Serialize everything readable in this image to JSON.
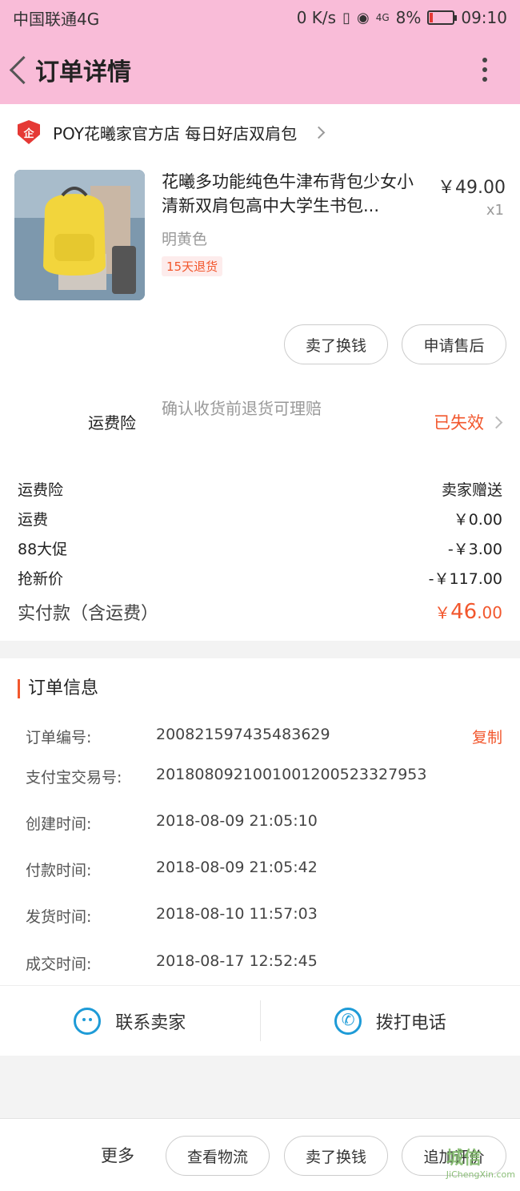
{
  "status_bar": {
    "carrier": "中国联通4G",
    "speed": "0 K/s",
    "signal": "4G",
    "battery": "8%",
    "time": "09:10"
  },
  "header": {
    "title": "订单详情"
  },
  "shop": {
    "badge": "企",
    "name": "POY花曦家官方店 每日好店双肩包"
  },
  "product": {
    "title": "花曦多功能纯色牛津布背包少女小清新双肩包高中大学生书包...",
    "price": "￥49.00",
    "qty": "x1",
    "color": "明黄色",
    "tag": "15天退货",
    "buttons": {
      "sell": "卖了换钱",
      "after_sale": "申请售后"
    }
  },
  "insurance": {
    "label": "运费险",
    "desc": "确认收货前退货可理赔",
    "status": "已失效"
  },
  "fees": {
    "rows": [
      {
        "label": "运费险",
        "value": "卖家赠送"
      },
      {
        "label": "运费",
        "value": "￥0.00"
      },
      {
        "label": "88大促",
        "value": "-￥3.00"
      },
      {
        "label": "抢新价",
        "value": "-￥117.00"
      }
    ],
    "total_label": "实付款（含运费）",
    "total_currency": "￥",
    "total_int": "46",
    "total_dec": ".00"
  },
  "order_info": {
    "heading": "订单信息",
    "copy_label": "复制",
    "rows": [
      {
        "label": "订单编号:",
        "value": "200821597435483629"
      },
      {
        "label": "支付宝交易号:",
        "value": "2018080921001001200523327953"
      },
      {
        "label": "创建时间:",
        "value": "2018-08-09 21:05:10"
      },
      {
        "label": "付款时间:",
        "value": "2018-08-09 21:05:42"
      },
      {
        "label": "发货时间:",
        "value": "2018-08-10 11:57:03"
      },
      {
        "label": "成交时间:",
        "value": "2018-08-17 12:52:45"
      }
    ]
  },
  "contact": {
    "seller": "联系卖家",
    "call": "拨打电话"
  },
  "bottom": {
    "more": "更多",
    "logistics": "查看物流",
    "sell": "卖了换钱",
    "review": "追加评价"
  },
  "watermark": {
    "main": "城信",
    "sub": "JiChengXin.com"
  },
  "colors": {
    "header_bg": "#f9bcd8",
    "accent": "#f2572d",
    "icon_blue": "#1e9bd7"
  }
}
